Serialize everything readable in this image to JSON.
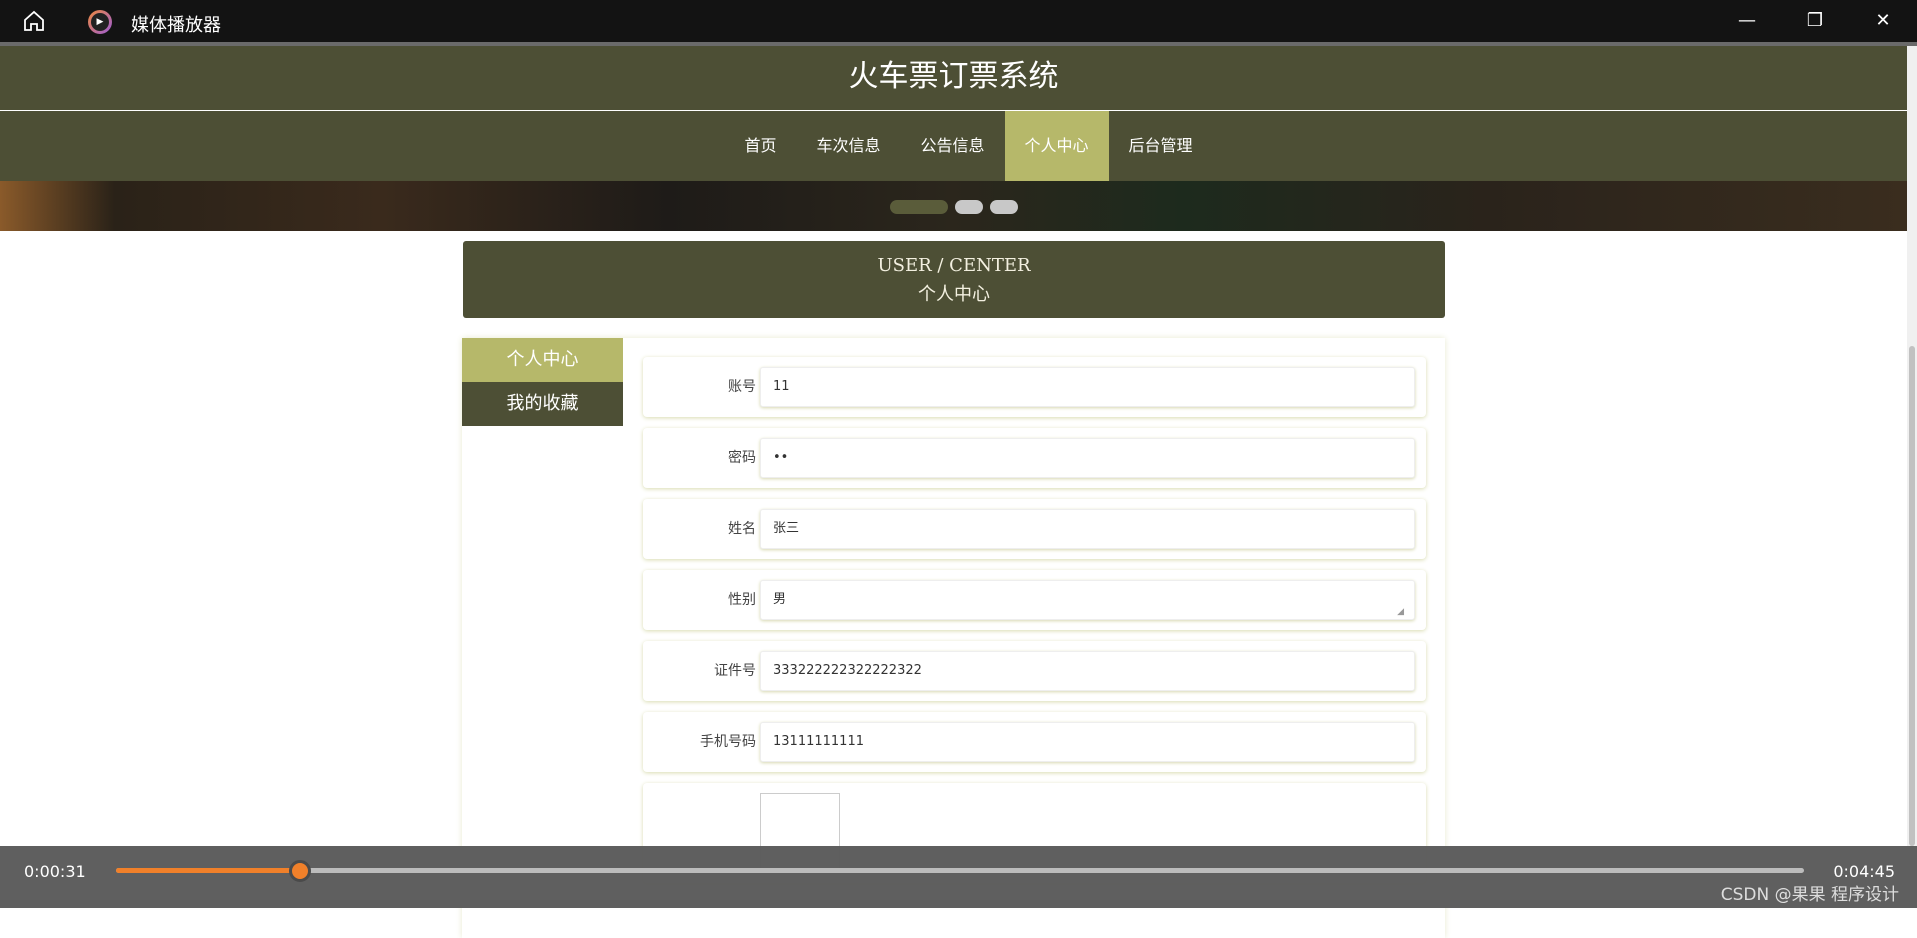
{
  "window": {
    "title": "媒体播放器"
  },
  "site": {
    "title": "火车票订票系统",
    "nav": [
      {
        "label": "首页"
      },
      {
        "label": "车次信息"
      },
      {
        "label": "公告信息"
      },
      {
        "label": "个人中心",
        "active": true
      },
      {
        "label": "后台管理"
      }
    ]
  },
  "banner": {
    "slides": 3,
    "active": 1
  },
  "center": {
    "en": "USER / CENTER",
    "cn": "个人中心"
  },
  "sidebar": [
    {
      "label": "个人中心"
    },
    {
      "label": "我的收藏"
    }
  ],
  "form": [
    {
      "label": "账号",
      "value": "11"
    },
    {
      "label": "密码",
      "value": "••"
    },
    {
      "label": "姓名",
      "value": "张三"
    },
    {
      "label": "性别",
      "value": "男"
    },
    {
      "label": "证件号",
      "value": "333222222322222322"
    },
    {
      "label": "手机号码",
      "value": "13111111111"
    }
  ],
  "player": {
    "current": "0:00:31",
    "total": "0:04:45",
    "progress_percent": 10.9,
    "watermark": "CSDN @果果 程序设计"
  },
  "colors": {
    "primary": "#4d4f35",
    "accent": "#b6b86a",
    "progress": "#f0802a"
  }
}
